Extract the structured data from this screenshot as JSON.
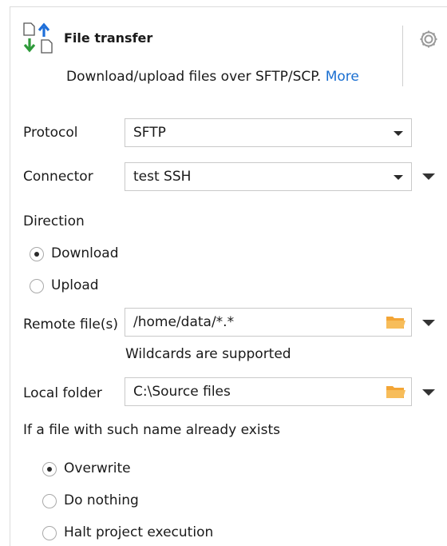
{
  "header": {
    "title": "File transfer",
    "description": "Download/upload files over SFTP/SCP.",
    "more_link": "More"
  },
  "protocol": {
    "label": "Protocol",
    "value": "SFTP"
  },
  "connector": {
    "label": "Connector",
    "value": "test SSH"
  },
  "direction": {
    "label": "Direction",
    "options": [
      {
        "label": "Download",
        "checked": true
      },
      {
        "label": "Upload",
        "checked": false
      }
    ]
  },
  "remote": {
    "label": "Remote file(s)",
    "value": "/home/data/*.*",
    "hint": "Wildcards are supported"
  },
  "local": {
    "label": "Local folder",
    "value": "C:\\Source files"
  },
  "exists": {
    "label": "If a file with such name already exists",
    "options": [
      {
        "label": "Overwrite",
        "checked": true
      },
      {
        "label": "Do nothing",
        "checked": false
      },
      {
        "label": "Halt project execution",
        "checked": false
      }
    ]
  },
  "icons": {
    "header": "file-transfer-icon",
    "settings": "gear-icon",
    "folder": "folder-icon"
  },
  "colors": {
    "link": "#1a6fd1",
    "folder": "#f3a536",
    "arrow_up": "#1e6fd9",
    "arrow_down": "#2e9a3a"
  }
}
